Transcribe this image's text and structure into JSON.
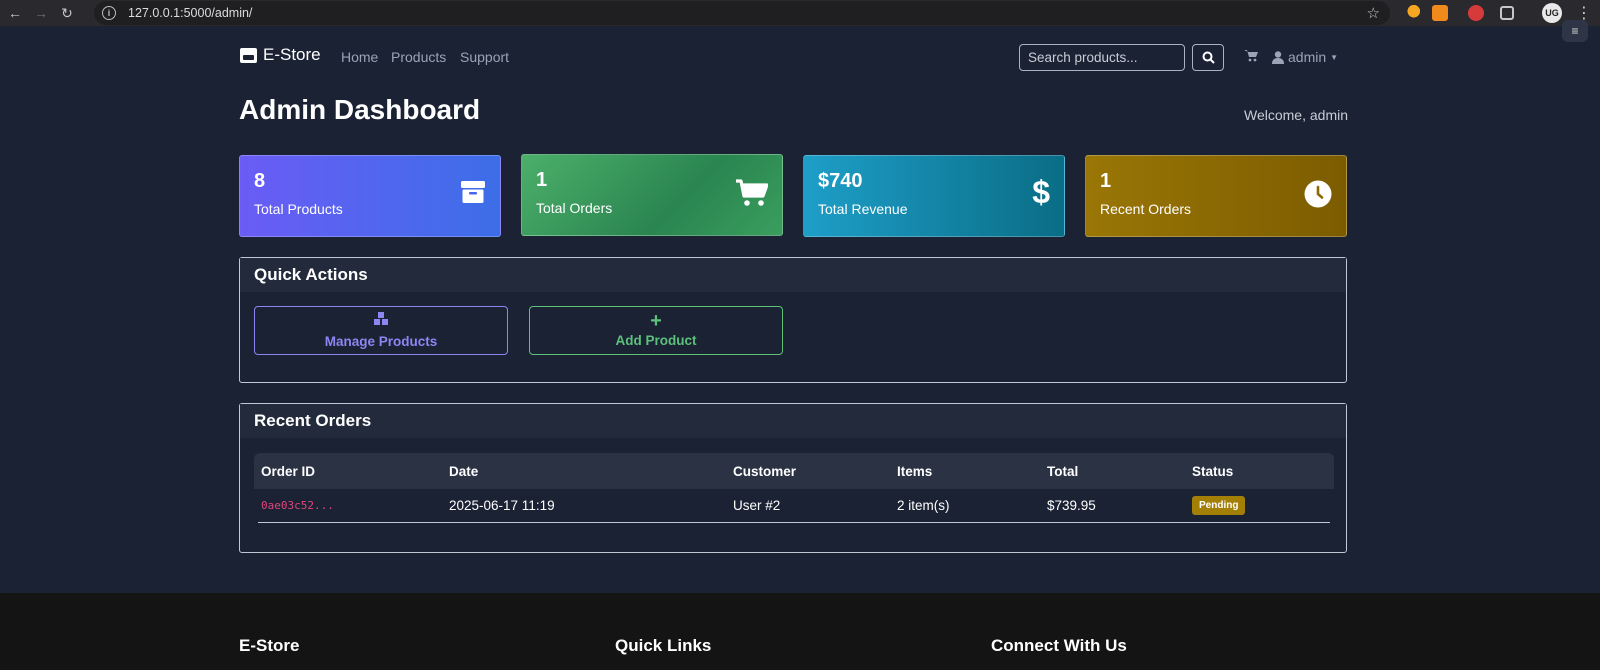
{
  "browser": {
    "url": "127.0.0.1:5000/admin/",
    "profile_initials": "UG"
  },
  "nav": {
    "brand": "E-Store",
    "links": [
      "Home",
      "Products",
      "Support"
    ],
    "search_placeholder": "Search products...",
    "user": "admin"
  },
  "header": {
    "title": "Admin Dashboard",
    "welcome": "Welcome, admin"
  },
  "stats": [
    {
      "value": "8",
      "label": "Total Products",
      "icon": "box-icon"
    },
    {
      "value": "1",
      "label": "Total Orders",
      "icon": "cart-icon"
    },
    {
      "value": "$740",
      "label": "Total Revenue",
      "icon": "dollar-icon"
    },
    {
      "value": "1",
      "label": "Recent Orders",
      "icon": "clock-icon"
    }
  ],
  "quick_actions": {
    "title": "Quick Actions",
    "manage_products": "Manage Products",
    "add_product": "Add Product"
  },
  "recent_orders": {
    "title": "Recent Orders",
    "columns": [
      "Order ID",
      "Date",
      "Customer",
      "Items",
      "Total",
      "Status"
    ],
    "rows": [
      {
        "order_id": "0ae03c52...",
        "date": "2025-06-17 11:19",
        "customer": "User #2",
        "items": "2 item(s)",
        "total": "$739.95",
        "status": "Pending"
      }
    ]
  },
  "footer": {
    "brand": "E-Store",
    "quick_links": "Quick Links",
    "connect": "Connect With Us"
  },
  "colors": {
    "page_bg": "#1a2234",
    "products_card": "#5a62f0",
    "orders_card": "#3a9e5e",
    "revenue_card": "#128aa8",
    "recent_card": "#8c6a04",
    "pending_badge": "#a37f06"
  }
}
